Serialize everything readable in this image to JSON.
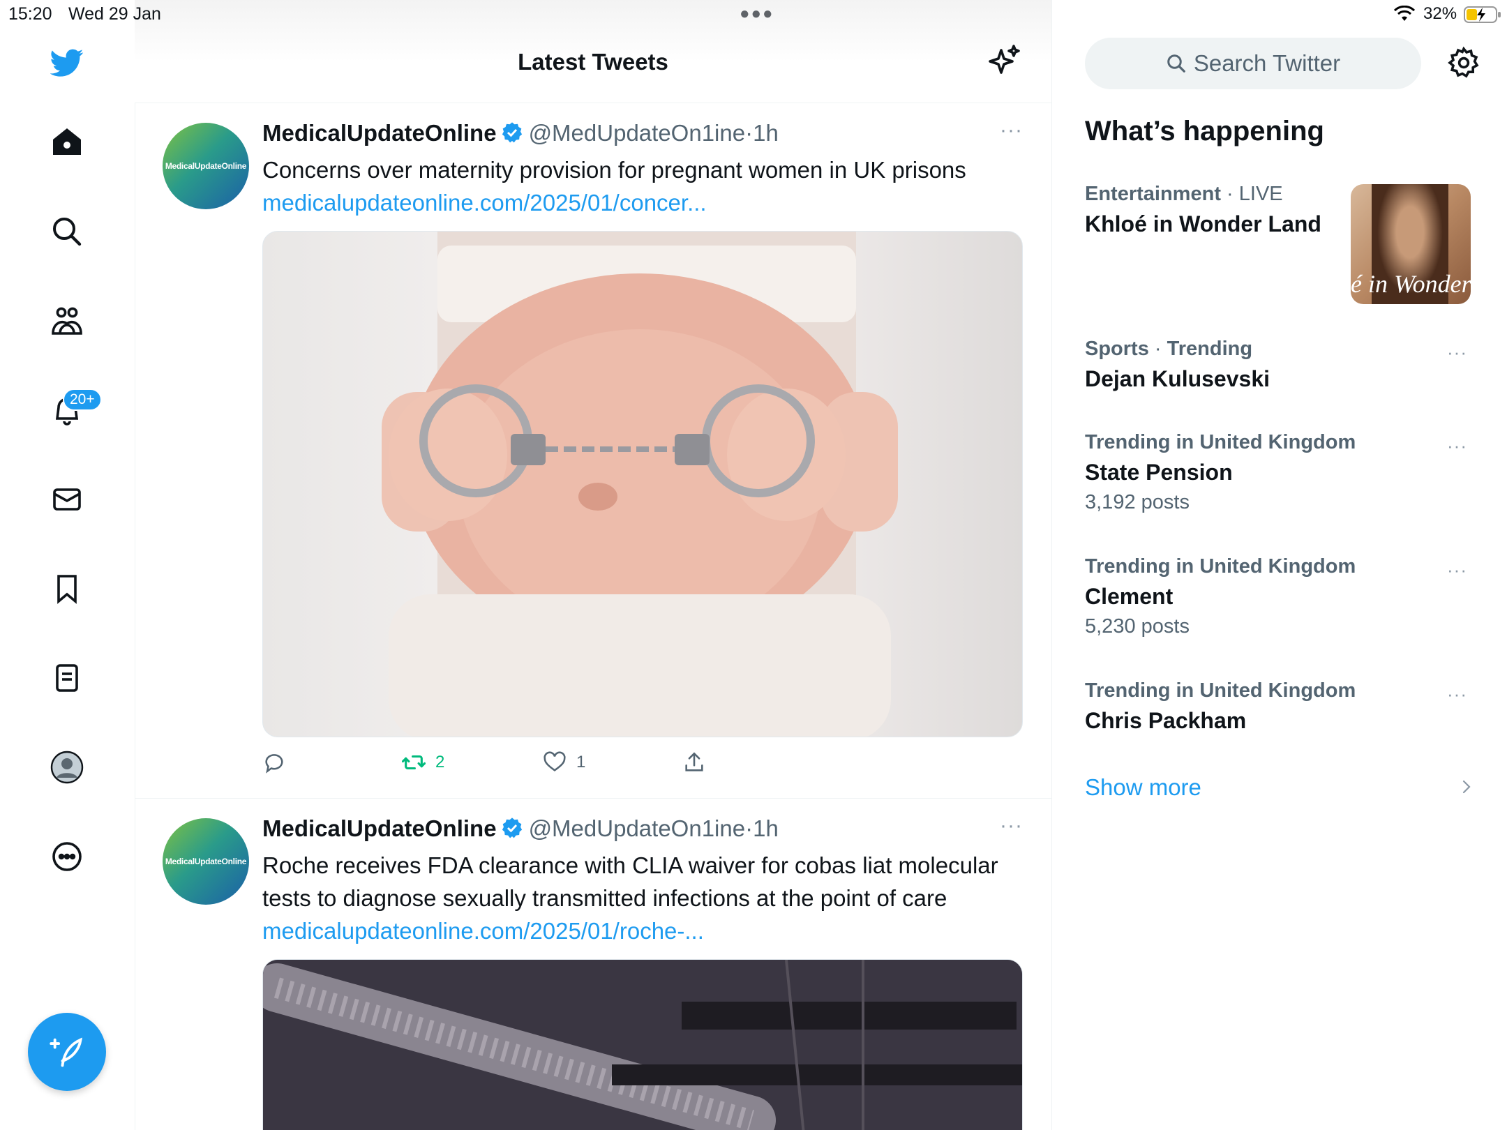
{
  "status_bar": {
    "time": "15:20",
    "date": "Wed 29 Jan",
    "battery": "32%"
  },
  "sidebar": {
    "notification_badge": "20+"
  },
  "header": {
    "title": "Latest Tweets"
  },
  "tweets": [
    {
      "name": "MedicalUpdateOnline",
      "handle": "@MedUpdateOn1ine",
      "dot": "·",
      "time": "1h",
      "text": "Concerns over maternity provision for pregnant women in UK prisons",
      "link": "medicalupdateonline.com/2025/01/concer...",
      "avatar_text": "MedicalUpdateOnline",
      "more": "···",
      "retweets": "2",
      "likes": "1"
    },
    {
      "name": "MedicalUpdateOnline",
      "handle": "@MedUpdateOn1ine",
      "dot": "·",
      "time": "1h",
      "text": "Roche receives FDA clearance with CLIA waiver for cobas liat molecular tests to diagnose sexually transmitted infections at the point of care",
      "link": "medicalupdateonline.com/2025/01/roche-...",
      "avatar_text": "MedicalUpdateOnline",
      "more": "···"
    }
  ],
  "right": {
    "search_placeholder": "Search Twitter",
    "whats_happening": "What’s happening",
    "trends": [
      {
        "category": "Entertainment",
        "sep": " · ",
        "qualifier": "LIVE",
        "name": "Khloé in Wonder Land",
        "image_text": "é in Wonder L"
      },
      {
        "category": "Sports",
        "sep": " · ",
        "qualifier": "Trending",
        "name": "Dejan Kulusevski"
      },
      {
        "category": "Trending in United Kingdom",
        "name": "State Pension",
        "count": "3,192 posts"
      },
      {
        "category": "Trending in United Kingdom",
        "name": "Clement",
        "count": "5,230 posts"
      },
      {
        "category": "Trending in United Kingdom",
        "name": "Chris Packham"
      }
    ],
    "more_dots": "···",
    "show_more": "Show more"
  },
  "colors": {
    "accent": "#1d9bf0",
    "secondary_text": "#536471",
    "retweet_green": "#00ba7c"
  }
}
